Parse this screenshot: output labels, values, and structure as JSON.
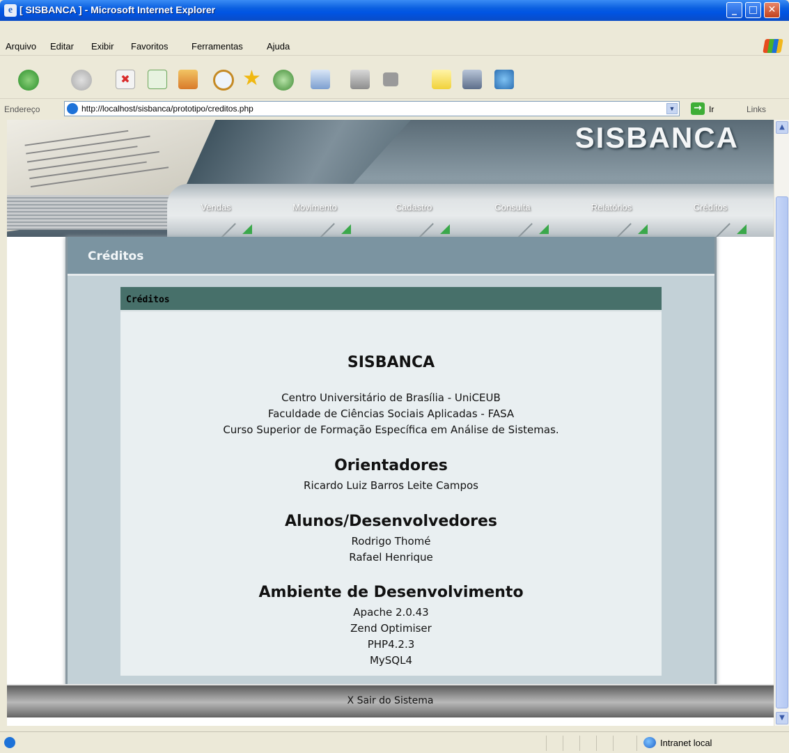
{
  "window": {
    "title": "[ SISBANCA ] - Microsoft Internet Explorer"
  },
  "menu": [
    "Arquivo",
    "Editar",
    "Exibir",
    "Favoritos",
    "Ferramentas",
    "Ajuda"
  ],
  "address": {
    "label": "Endereço",
    "url": "http://localhost/sisbanca/prototipo/creditos.php",
    "go": "Ir",
    "links": "Links"
  },
  "banner": {
    "brand": "SISBANCA"
  },
  "nav": [
    "Vendas",
    "Movimento",
    "Cadastro",
    "Consulta",
    "Relatórios",
    "Créditos"
  ],
  "page": {
    "title": "Créditos"
  },
  "card": {
    "title": "Créditos",
    "app_name": "SISBANCA",
    "institution": [
      "Centro Universitário de Brasília - UniCEUB",
      "Faculdade de Ciências Sociais Aplicadas - FASA",
      "Curso Superior de Formação Específica em Análise de Sistemas."
    ],
    "advisors_heading": "Orientadores",
    "advisors": [
      "Ricardo Luiz Barros Leite Campos"
    ],
    "students_heading": "Alunos/Desenvolvedores",
    "students": [
      "Rodrigo Thomé",
      "Rafael Henrique"
    ],
    "env_heading": "Ambiente de Desenvolvimento",
    "env": [
      "Apache 2.0.43",
      "Zend Optimiser",
      "PHP4.2.3",
      "MySQL4"
    ]
  },
  "footer": {
    "logout": "X Sair do Sistema"
  },
  "status": {
    "zone": "Intranet local"
  },
  "colors": {
    "titlebar": "#0054e3",
    "page_head": "#7b94a1",
    "card_head": "#47706a",
    "panel": "#c3d1d7"
  }
}
